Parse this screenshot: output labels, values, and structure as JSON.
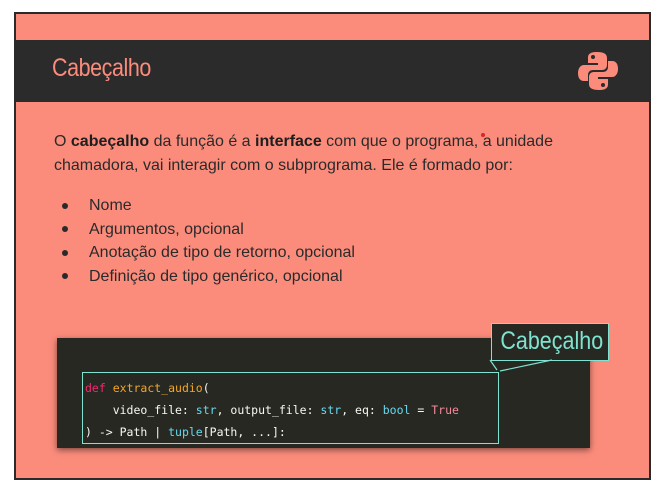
{
  "header": {
    "title": "Cabeçalho",
    "logo": "python-logo-icon",
    "bar_color": "#2b2b2b",
    "title_color": "#fb8c7c"
  },
  "intro": {
    "part1": "O ",
    "bold1": "cabeçalho",
    "part2": " da função é a ",
    "bold2": "interface",
    "part3": " com que o programa, a unidade chamadora, vai interagir com o subprograma. Ele é formado por:"
  },
  "bullets": [
    "Nome",
    "Argumentos, opcional",
    "Anotação de tipo de retorno, opcional",
    "Definição de tipo genérico, opcional"
  ],
  "code": {
    "line1": {
      "kw": "def",
      "fn": "extract_audio",
      "rest": "("
    },
    "line2": {
      "a": "    video_file: ",
      "t1": "str",
      "b": ", output_file: ",
      "t2": "str",
      "c": ", eq: ",
      "t3": "bool",
      "d": " = ",
      "v": "True"
    },
    "line3": {
      "a": ") -> Path | ",
      "t": "tuple",
      "b": "[Path, ...]:"
    }
  },
  "tag": {
    "label": "Cabeçalho",
    "color": "#7ee3d0"
  },
  "colors": {
    "background": "#fb8c7c",
    "code_bg": "#272822"
  }
}
